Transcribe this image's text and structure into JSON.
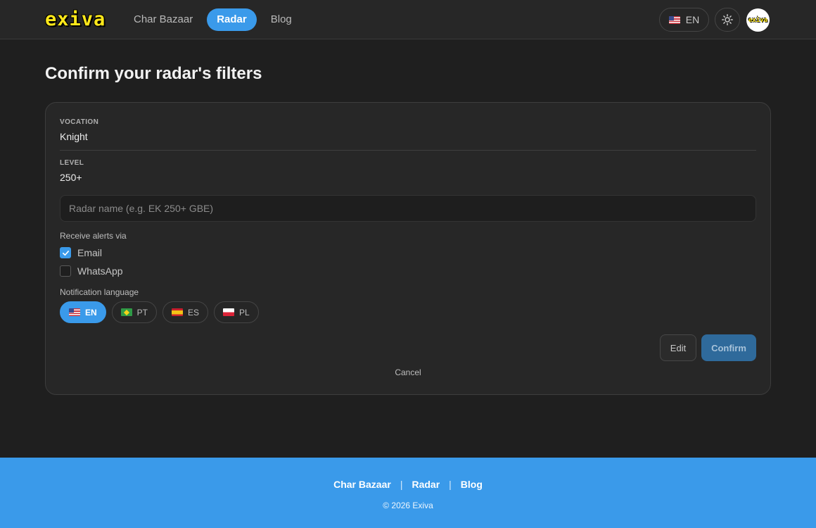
{
  "header": {
    "logo_text": "exiva",
    "nav": [
      {
        "label": "Char Bazaar",
        "active": false
      },
      {
        "label": "Radar",
        "active": true
      },
      {
        "label": "Blog",
        "active": false
      }
    ],
    "language_label": "EN",
    "avatar_text": "exiva",
    "icons": {
      "language_flag": "us-flag-icon",
      "theme": "sun-icon"
    }
  },
  "page": {
    "title": "Confirm your radar's filters"
  },
  "filters": {
    "vocation_label": "VOCATION",
    "vocation_value": "Knight",
    "level_label": "LEVEL",
    "level_value": "250+"
  },
  "radar_name": {
    "value": "",
    "placeholder": "Radar name (e.g. EK 250+ GBE)"
  },
  "alerts": {
    "label": "Receive alerts via",
    "options": [
      {
        "label": "Email",
        "checked": true
      },
      {
        "label": "WhatsApp",
        "checked": false
      }
    ]
  },
  "notification_language": {
    "label": "Notification language",
    "options": [
      {
        "code": "EN",
        "flag": "us-flag-icon",
        "active": true
      },
      {
        "code": "PT",
        "flag": "brazil-flag-icon",
        "active": false
      },
      {
        "code": "ES",
        "flag": "spain-flag-icon",
        "active": false
      },
      {
        "code": "PL",
        "flag": "poland-flag-icon",
        "active": false
      }
    ]
  },
  "actions": {
    "edit_label": "Edit",
    "confirm_label": "Confirm",
    "cancel_label": "Cancel"
  },
  "footer": {
    "links": [
      "Char Bazaar",
      "Radar",
      "Blog"
    ],
    "separator": "|",
    "copyright": "© 2026 Exiva"
  },
  "colors": {
    "accent": "#3a9aea",
    "background": "#1f1f1f",
    "card": "#272727",
    "logo_yellow": "#ffe81a"
  }
}
